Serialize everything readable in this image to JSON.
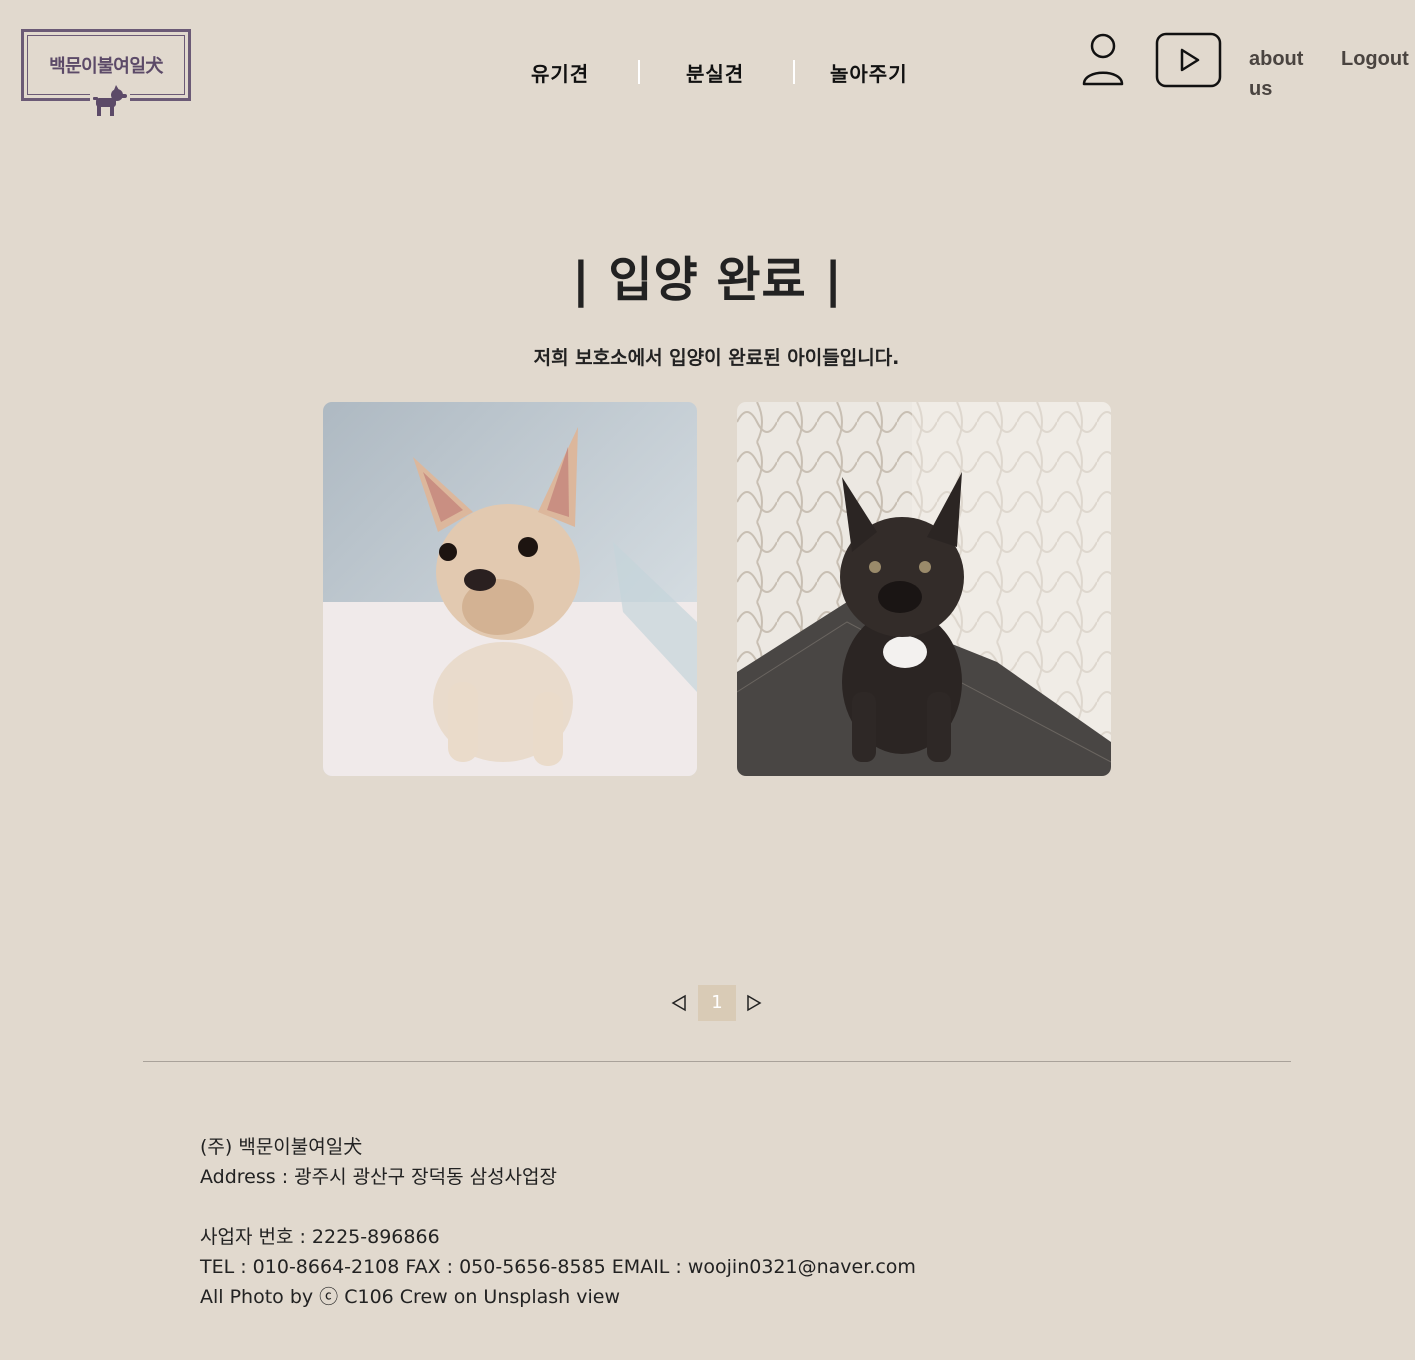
{
  "logo": {
    "text": "백문이불여일犬"
  },
  "nav": {
    "items": [
      {
        "label": "유기견"
      },
      {
        "label": "분실견"
      },
      {
        "label": "놀아주기"
      }
    ]
  },
  "header": {
    "about_label": "about us",
    "logout_label": "Logout",
    "icons": [
      "user-icon",
      "youtube-play-icon"
    ]
  },
  "main": {
    "title": "| 입양 완료 |",
    "subtitle": "저희 보호소에서 입양이 완료된 아이들입니다.",
    "photos": [
      {
        "description_icon": "cream-french-bulldog-photo"
      },
      {
        "description_icon": "brindle-french-bulldog-photo"
      }
    ]
  },
  "pagination": {
    "current_page": "1",
    "icons": [
      "prev-icon",
      "next-icon"
    ]
  },
  "footer": {
    "company": "(주) 백문이불여일犬",
    "address": "Address : 광주시 광산구 장덕동 삼성사업장",
    "business_no": "사업자 번호 : 2225-896866",
    "contact": "TEL : 010-8664-2108 FAX : 050-5656-8585 EMAIL : woojin0321@naver.com",
    "credit": "All Photo by ⓒ C106 Crew on Unsplash view"
  },
  "colors": {
    "background": "#e1d9ce",
    "logo": "#6b5a76",
    "pager_active": "#d9cbb6"
  }
}
